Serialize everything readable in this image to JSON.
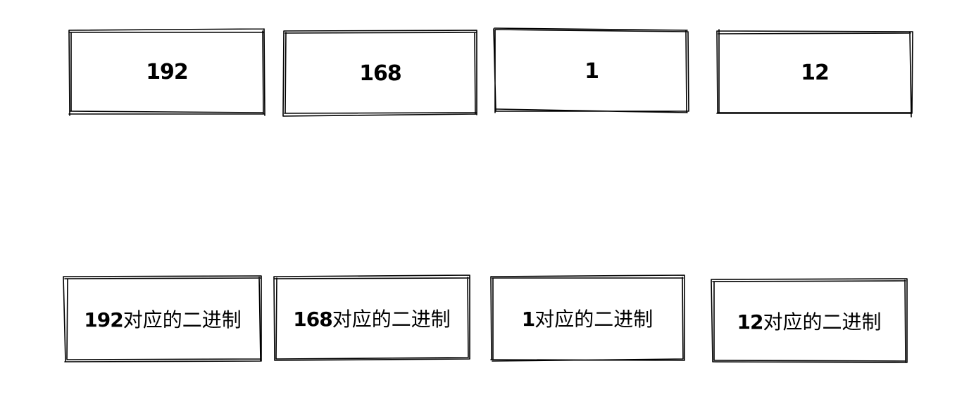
{
  "octets": [
    {
      "value": "192"
    },
    {
      "value": "168"
    },
    {
      "value": "1"
    },
    {
      "value": "12"
    }
  ],
  "binary_boxes": [
    {
      "number": "192",
      "suffix": "对应的二进制"
    },
    {
      "number": "168",
      "suffix": "对应的二进制"
    },
    {
      "number": "1",
      "suffix": "对应的二进制"
    },
    {
      "number": "12",
      "suffix": "对应的二进制"
    }
  ],
  "colors": {
    "stroke": "#000000",
    "background": "#ffffff"
  }
}
